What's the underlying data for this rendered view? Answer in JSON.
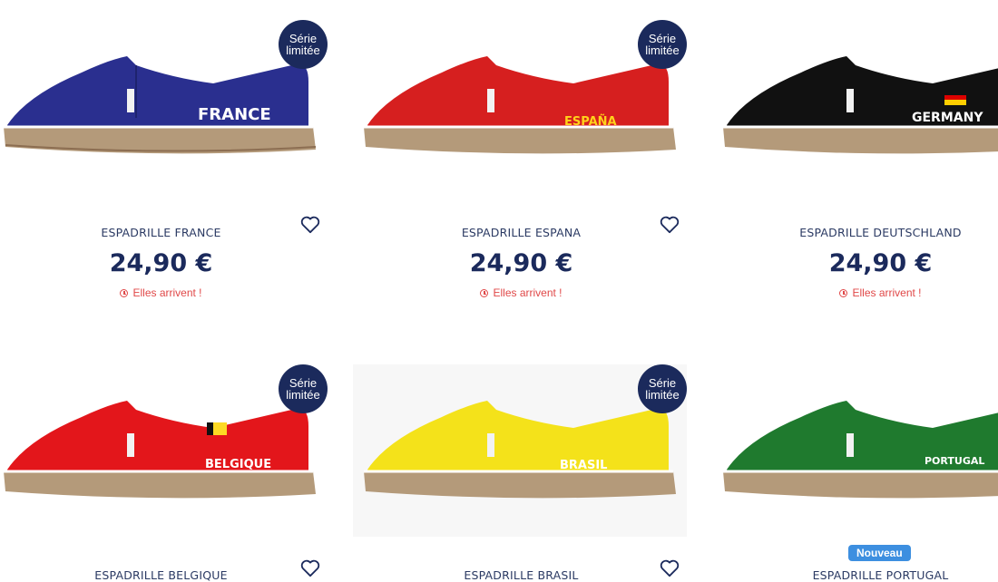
{
  "products": [
    {
      "name": "ESPADRILLE FRANCE",
      "price": "24,90 €",
      "status": "Elles arrivent !",
      "badge_line1": "Série",
      "badge_line2": "limitée",
      "print_text": "FRANCE",
      "color": "#2a2f8f",
      "accent": "#ffffff"
    },
    {
      "name": "ESPADRILLE ESPANA",
      "price": "24,90 €",
      "status": "Elles arrivent !",
      "badge_line1": "Série",
      "badge_line2": "limitée",
      "print_text": "ESPAÑA",
      "color": "#d61f1f",
      "accent": "#ffd21a"
    },
    {
      "name": "ESPADRILLE DEUTSCHLAND",
      "price": "24,90 €",
      "status": "Elles arrivent !",
      "print_text": "GERMANY",
      "color": "#111111",
      "accent": "#ffffff"
    },
    {
      "name": "ESPADRILLE BELGIQUE",
      "badge_line1": "Série",
      "badge_line2": "limitée",
      "print_text": "BELGIQUE",
      "color": "#e3161b",
      "accent": "#ffffff"
    },
    {
      "name": "ESPADRILLE BRASIL",
      "badge_line1": "Série",
      "badge_line2": "limitée",
      "print_text": "BRASIL",
      "color": "#f4e21a",
      "accent": "#ffffff"
    },
    {
      "name": "ESPADRILLE PORTUGAL",
      "badge_new": "Nouveau",
      "print_text": "PORTUGAL",
      "color": "#1f7a2e",
      "accent": "#ffffff"
    }
  ]
}
